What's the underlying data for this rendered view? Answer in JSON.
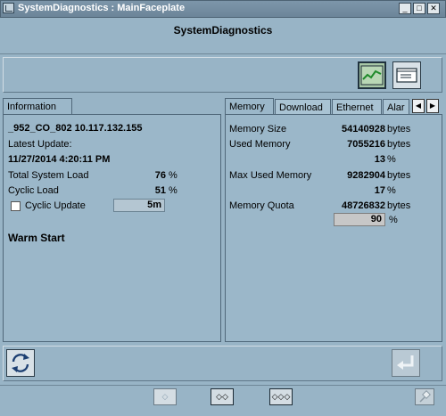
{
  "window": {
    "title": "SystemDiagnostics : MainFaceplate",
    "minimize_glyph": "_",
    "maximize_glyph": "□",
    "close_glyph": "✕"
  },
  "header": {
    "title": "SystemDiagnostics"
  },
  "toolbar": {
    "trend_icon": "trend-chart-icon",
    "faceplate_icon": "faceplate-window-icon"
  },
  "left_panel": {
    "tab_label": "Information",
    "device": "_952_CO_802 10.117.132.155",
    "latest_update_label": "Latest Update:",
    "latest_update_value": "11/27/2014 4:20:11 PM",
    "total_load_label": "Total System Load",
    "total_load_value": "76",
    "cyclic_load_label": "Cyclic Load",
    "cyclic_load_value": "51",
    "percent_unit": "%",
    "cyclic_update_label": "Cyclic Update",
    "cyclic_update_checked": false,
    "cyclic_update_interval": "5m",
    "start_mode": "Warm Start"
  },
  "right_panel": {
    "tabs": [
      "Memory",
      "Download",
      "Ethernet",
      "Alar"
    ],
    "active_tab": "Memory",
    "scroll_left_glyph": "◀",
    "scroll_right_glyph": "▶",
    "bytes_unit": "bytes",
    "percent_unit": "%",
    "memory_size_label": "Memory Size",
    "memory_size_value": "54140928",
    "used_memory_label": "Used Memory",
    "used_memory_value": "7055216",
    "used_memory_percent": "13",
    "max_used_label": "Max Used Memory",
    "max_used_value": "9282904",
    "max_used_percent": "17",
    "quota_label": "Memory Quota",
    "quota_value": "48726832",
    "quota_percent": "90"
  },
  "bottom_toolbar": {
    "refresh_icon": "refresh-icon",
    "return_icon": "return-arrow-icon"
  },
  "statusbar": {
    "view_small_glyph": "◇",
    "view_medium_glyph": "◇◇",
    "view_large_glyph": "◇◇◇",
    "pin_icon": "pin-icon"
  }
}
